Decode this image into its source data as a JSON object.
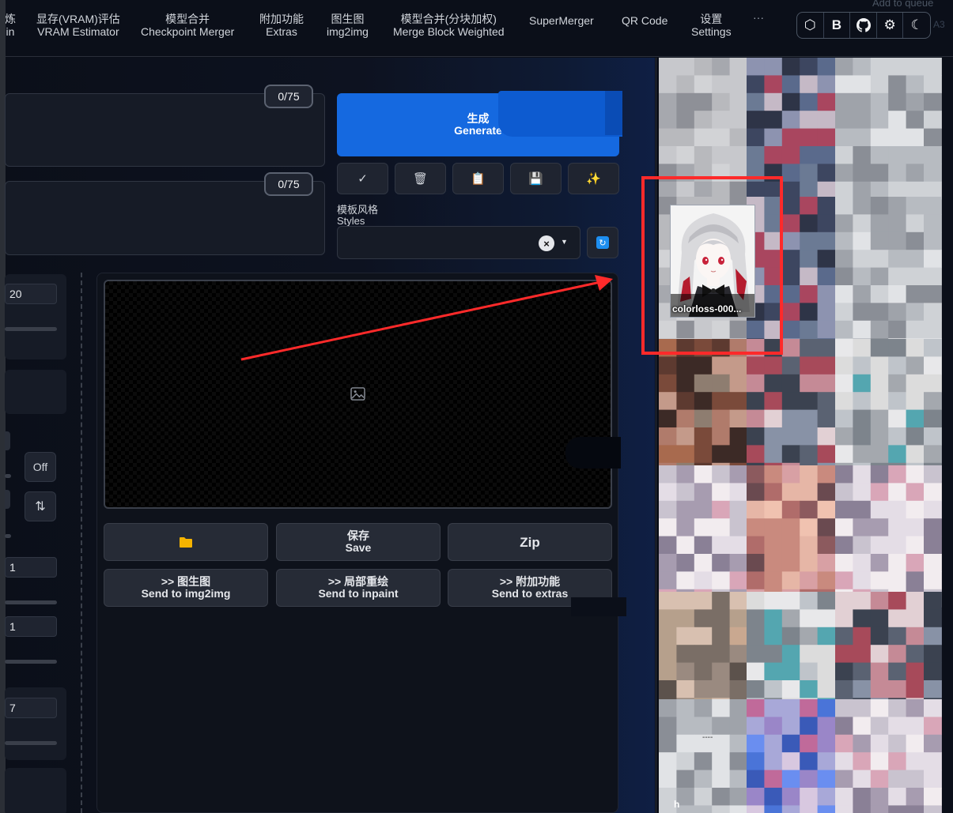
{
  "nav": {
    "tabs": [
      {
        "zh": "炼",
        "en": "in"
      },
      {
        "zh": "显存(VRAM)评估",
        "en": "VRAM Estimator"
      },
      {
        "zh": "模型合并",
        "en": "Checkpoint Merger"
      },
      {
        "zh": "附加功能",
        "en": "Extras"
      },
      {
        "zh": "图生图",
        "en": "img2img"
      },
      {
        "zh": "模型合并(分块加权)",
        "en": "Merge Block Weighted"
      },
      {
        "zh": "SuperMerger",
        "en": ""
      },
      {
        "zh": "QR Code",
        "en": ""
      },
      {
        "zh": "设置",
        "en": "Settings"
      }
    ],
    "more": "···",
    "icon_buttons": [
      {
        "name": "hexagon-icon",
        "glyph": "⬡"
      },
      {
        "name": "bold-b-icon",
        "glyph": "B"
      },
      {
        "name": "github-icon",
        "glyph": "●"
      },
      {
        "name": "gear-icon",
        "glyph": "⚙"
      },
      {
        "name": "moon-icon",
        "glyph": "☾"
      }
    ],
    "ghost_queue_text": "Add to queue",
    "ghost_a3": "A3"
  },
  "prompt": {
    "tokens": "0/75"
  },
  "negative_prompt": {
    "tokens": "0/75"
  },
  "generate": {
    "zh": "生成",
    "en": "Generate"
  },
  "tools": [
    {
      "name": "checkmark-icon",
      "glyph": "✓"
    },
    {
      "name": "trash-icon",
      "glyph": "🗑"
    },
    {
      "name": "clipboard-icon",
      "glyph": "📋"
    },
    {
      "name": "save-icon",
      "glyph": "💾"
    },
    {
      "name": "magic-wand-icon",
      "glyph": "✨"
    }
  ],
  "styles": {
    "label_zh": "模板风格",
    "label_en": "Styles",
    "clear": "×",
    "caret": "▼",
    "refresh": "↻"
  },
  "settings": {
    "steps": "20",
    "hires": "Off",
    "swap": "⇅",
    "batch_count": "1",
    "batch_size": "1",
    "cfg": "7"
  },
  "actions": {
    "folder": "📁",
    "save_zh": "保存",
    "save_en": "Save",
    "zip": "Zip",
    "img2img_zh": ">> 图生图",
    "img2img_en": "Send to img2img",
    "inpaint_zh": ">> 局部重绘",
    "inpaint_en": "Send to inpaint",
    "extras_zh": ">> 附加功能",
    "extras_en": "Send to extras"
  },
  "gallery": {
    "selected_caption": "colorloss-000...",
    "bottom_caption": "h",
    "mini_caption": "----"
  },
  "colors": {
    "accent": "#1569e0",
    "annotation": "#ff2a2a",
    "folder": "#f5b300"
  }
}
